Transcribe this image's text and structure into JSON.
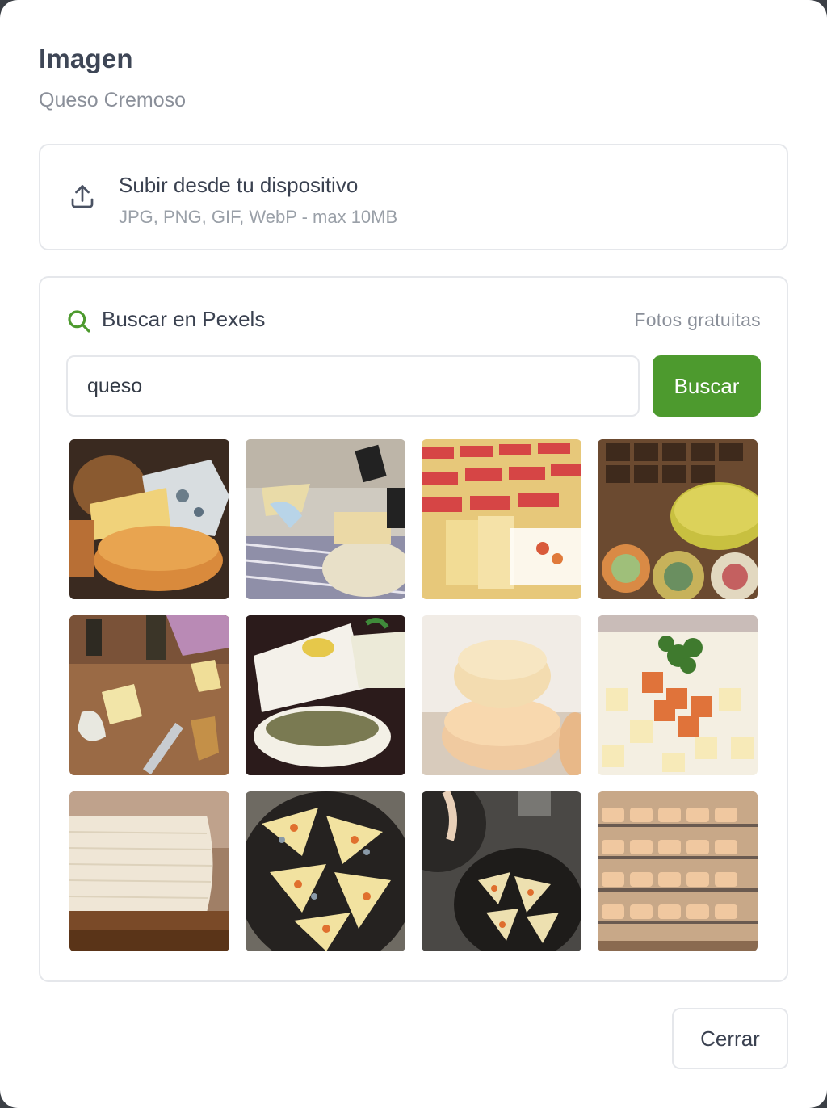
{
  "dialog": {
    "title": "Imagen",
    "subtitle": "Queso Cremoso"
  },
  "upload": {
    "title": "Subir desde tu dispositivo",
    "hint": "JPG, PNG, GIF, WebP - max 10MB",
    "icon": "upload-icon"
  },
  "pexels": {
    "title": "Buscar en Pexels",
    "note": "Fotos gratuitas",
    "icon": "search-icon",
    "query": "queso",
    "search_label": "Buscar",
    "accent": "#4d9a2e",
    "results": [
      {
        "subject": "blue cheese and bread"
      },
      {
        "subject": "cheese market stall"
      },
      {
        "subject": "packaged cheese blocks"
      },
      {
        "subject": "cheese wheels shop"
      },
      {
        "subject": "cheese on cutting board"
      },
      {
        "subject": "feta with olive oil"
      },
      {
        "subject": "stacked cheese rounds"
      },
      {
        "subject": "cheese cubes platter"
      },
      {
        "subject": "fresh cheese wheel"
      },
      {
        "subject": "cheese triangles plate"
      },
      {
        "subject": "cheese bowls table"
      },
      {
        "subject": "cheese aging shelves"
      }
    ]
  },
  "footer": {
    "close_label": "Cerrar"
  }
}
